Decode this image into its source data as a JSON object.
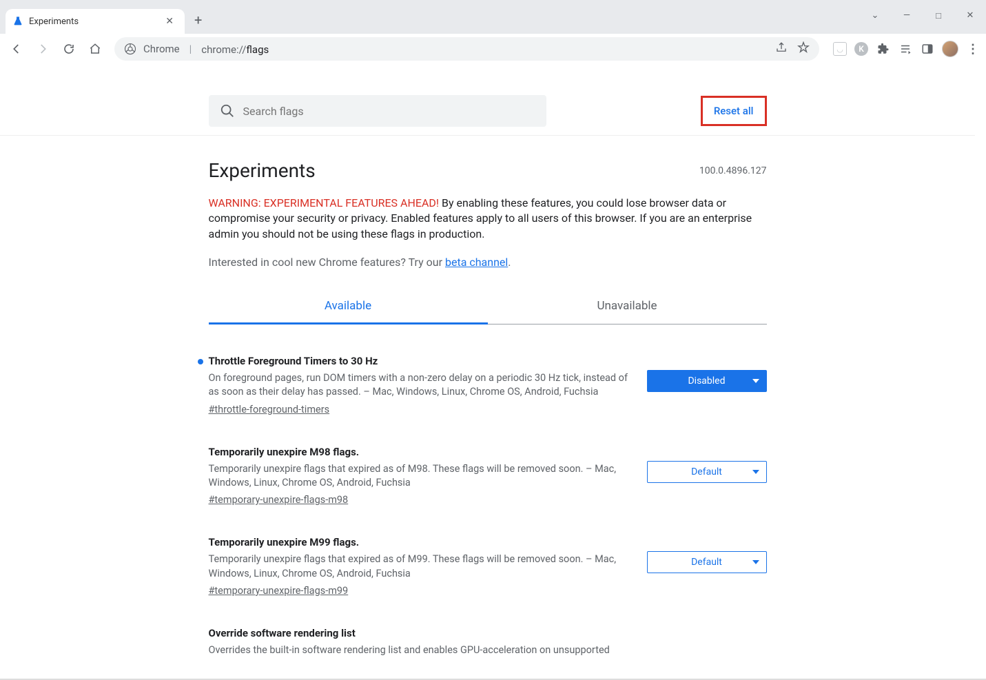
{
  "browser": {
    "tab_title": "Experiments",
    "url_label": "Chrome",
    "url_protocol": "chrome://",
    "url_path": "flags"
  },
  "search": {
    "placeholder": "Search flags",
    "reset_label": "Reset all"
  },
  "heading": "Experiments",
  "version": "100.0.4896.127",
  "warning_prefix": "WARNING: EXPERIMENTAL FEATURES AHEAD!",
  "warning_body": " By enabling these features, you could lose browser data or compromise your security or privacy. Enabled features apply to all users of this browser. If you are an enterprise admin you should not be using these flags in production.",
  "beta_prefix": "Interested in cool new Chrome features? Try our ",
  "beta_link": "beta channel",
  "tabs": {
    "available": "Available",
    "unavailable": "Unavailable"
  },
  "flags": [
    {
      "title": "Throttle Foreground Timers to 30 Hz",
      "desc": "On foreground pages, run DOM timers with a non-zero delay on a periodic 30 Hz tick, instead of as soon as their delay has passed. – Mac, Windows, Linux, Chrome OS, Android, Fuchsia",
      "anchor": "#throttle-foreground-timers",
      "state": "Disabled",
      "modified": true
    },
    {
      "title": "Temporarily unexpire M98 flags.",
      "desc": "Temporarily unexpire flags that expired as of M98. These flags will be removed soon. – Mac, Windows, Linux, Chrome OS, Android, Fuchsia",
      "anchor": "#temporary-unexpire-flags-m98",
      "state": "Default",
      "modified": false
    },
    {
      "title": "Temporarily unexpire M99 flags.",
      "desc": "Temporarily unexpire flags that expired as of M99. These flags will be removed soon. – Mac, Windows, Linux, Chrome OS, Android, Fuchsia",
      "anchor": "#temporary-unexpire-flags-m99",
      "state": "Default",
      "modified": false
    },
    {
      "title": "Override software rendering list",
      "desc": "Overrides the built-in software rendering list and enables GPU-acceleration on unsupported",
      "anchor": "",
      "state": "",
      "modified": false
    }
  ]
}
